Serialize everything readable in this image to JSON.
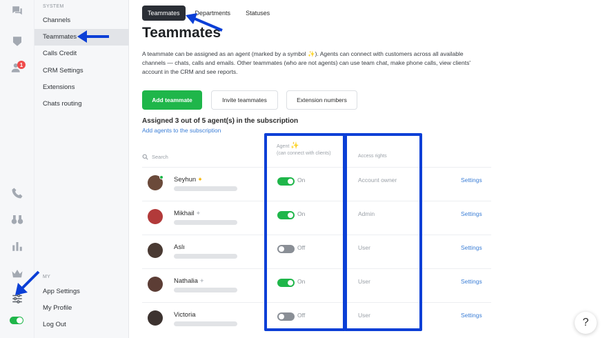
{
  "sidebar": {
    "section_system": "SYSTEM",
    "section_my": "MY",
    "items": [
      {
        "label": "Channels"
      },
      {
        "label": "Teammates"
      },
      {
        "label": "Calls Credit"
      },
      {
        "label": "CRM Settings"
      },
      {
        "label": "Extensions"
      },
      {
        "label": "Chats routing"
      }
    ],
    "my_items": [
      {
        "label": "App Settings"
      },
      {
        "label": "My Profile"
      },
      {
        "label": "Log Out"
      }
    ]
  },
  "rail": {
    "notification_count": "1",
    "icons": [
      "chat-icon",
      "badge-icon",
      "users-icon",
      "phone-icon",
      "binoculars-icon",
      "bar-chart-icon",
      "crown-icon",
      "sliders-icon"
    ]
  },
  "tabs": [
    {
      "label": "Teammates"
    },
    {
      "label": "Departments"
    },
    {
      "label": "Statuses"
    }
  ],
  "page": {
    "title": "Teammates",
    "desc_part1": "A teammate can be assigned as an agent (marked by a symbol ",
    "desc_part2": "). Agents can connect with customers across all available channels — chats, calls and emails. Other teammates (who are not agents) can use team chat, make phone calls, view clients' account in the CRM and see reports.",
    "sparkle": "✨"
  },
  "buttons": {
    "add_teammate": "Add teammate",
    "invite_teammates": "Invite teammates",
    "extension_numbers": "Extension numbers"
  },
  "subscription": {
    "assigned_text": "Assigned 3 out of 5 agent(s) in the subscription",
    "add_link": "Add agents to the subscription"
  },
  "table": {
    "search_placeholder": "Search",
    "agent_header": "Agent",
    "agent_subheader": "(can connect with clients)",
    "access_header": "Access rights",
    "settings_label": "Settings",
    "rows": [
      {
        "name": "Seyhun",
        "agent": true,
        "toggle_label": "On",
        "access": "Account owner",
        "avatar_color": "#6b4a3a",
        "online": true
      },
      {
        "name": "Mikhail",
        "agent": false,
        "toggle_label": "On",
        "access": "Admin",
        "avatar_color": "#b23a3a",
        "online": false
      },
      {
        "name": "Aslı",
        "agent": false,
        "toggle_label": "Off",
        "access": "User",
        "avatar_color": "#4a3a33",
        "online": false
      },
      {
        "name": "Nathalia",
        "agent": false,
        "toggle_label": "On",
        "access": "User",
        "avatar_color": "#5c3d35",
        "online": false
      },
      {
        "name": "Victoria",
        "agent": false,
        "toggle_label": "Off",
        "access": "User",
        "avatar_color": "#3d3330",
        "online": false
      }
    ]
  },
  "toggles_on": [
    true,
    true,
    false,
    true,
    false
  ],
  "help_label": "?",
  "colors": {
    "accent_green": "#1fb64a",
    "link_blue": "#3b7ed6",
    "highlight_blue": "#0b3fd6",
    "badge_red": "#ef4b4b"
  }
}
